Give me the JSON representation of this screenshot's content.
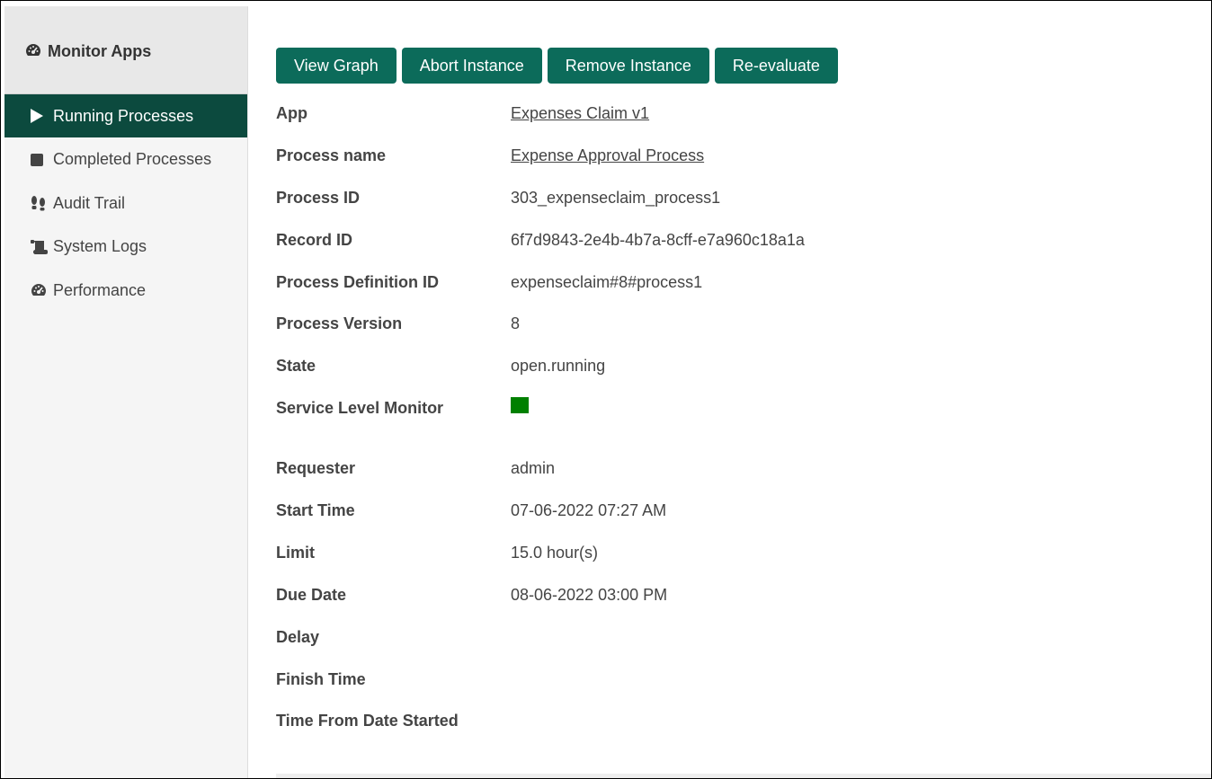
{
  "sidebar": {
    "title": "Monitor Apps",
    "title_icon": "dashboard-icon",
    "items": [
      {
        "label": "Running Processes",
        "icon": "play-icon",
        "active": true
      },
      {
        "label": "Completed Processes",
        "icon": "stop-icon",
        "active": false
      },
      {
        "label": "Audit Trail",
        "icon": "footprints-icon",
        "active": false
      },
      {
        "label": "System Logs",
        "icon": "scroll-icon",
        "active": false
      },
      {
        "label": "Performance",
        "icon": "dashboard-icon",
        "active": false
      }
    ]
  },
  "toolbar": {
    "view_graph": "View Graph",
    "abort_instance": "Abort Instance",
    "remove_instance": "Remove Instance",
    "re_evaluate": "Re-evaluate"
  },
  "details": {
    "app": {
      "label": "App",
      "value": "Expenses Claim v1"
    },
    "process_name": {
      "label": "Process name",
      "value": "Expense Approval Process"
    },
    "process_id": {
      "label": "Process ID",
      "value": "303_expenseclaim_process1"
    },
    "record_id": {
      "label": "Record ID",
      "value": "6f7d9843-2e4b-4b7a-8cff-e7a960c18a1a"
    },
    "process_definition_id": {
      "label": "Process Definition ID",
      "value": "expenseclaim#8#process1"
    },
    "process_version": {
      "label": "Process Version",
      "value": "8"
    },
    "state": {
      "label": "State",
      "value": "open.running"
    },
    "service_level_monitor": {
      "label": "Service Level Monitor",
      "color": "#008000"
    },
    "requester": {
      "label": "Requester",
      "value": "admin"
    },
    "start_time": {
      "label": "Start Time",
      "value": "07-06-2022 07:27 AM"
    },
    "limit": {
      "label": "Limit",
      "value": "15.0 hour(s)"
    },
    "due_date": {
      "label": "Due Date",
      "value": "08-06-2022 03:00 PM"
    },
    "delay": {
      "label": "Delay",
      "value": ""
    },
    "finish_time": {
      "label": "Finish Time",
      "value": ""
    },
    "time_from_date_started": {
      "label": "Time From Date Started",
      "value": ""
    }
  },
  "colors": {
    "accent": "#0c6b5a",
    "sidebar_active": "#0c4a3e"
  }
}
